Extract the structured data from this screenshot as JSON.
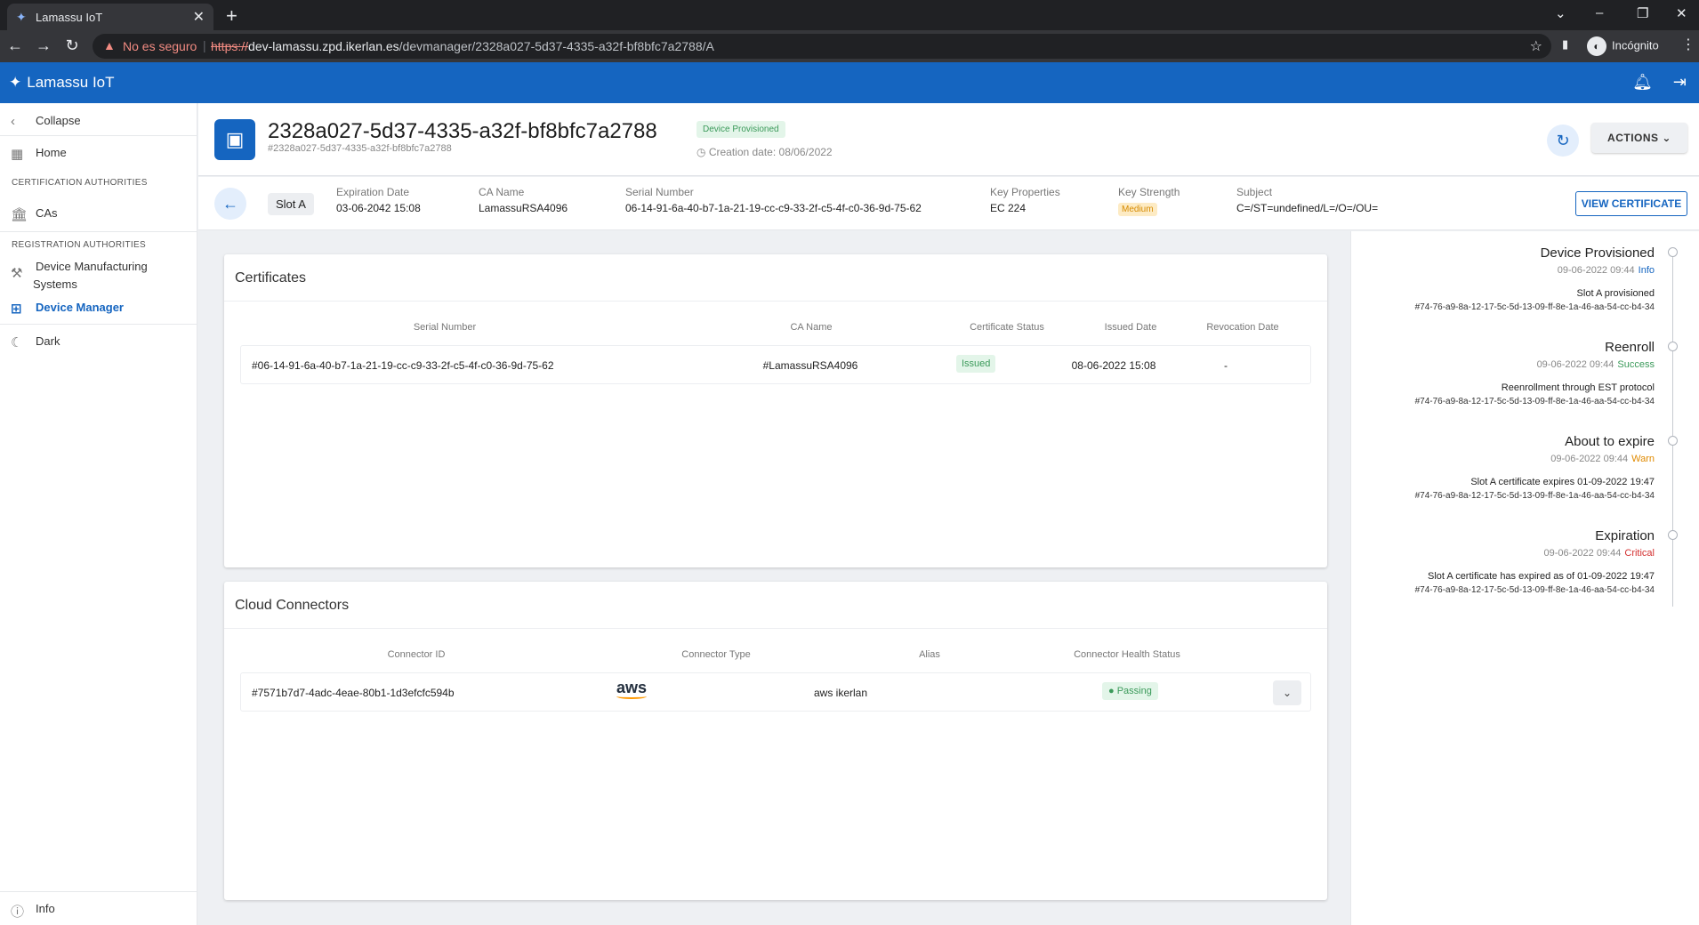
{
  "browser": {
    "tab_title": "Lamassu IoT",
    "tab_close": "✕",
    "new_tab": "+",
    "insecure_label": "No es seguro",
    "url_scheme": "https://",
    "url_host": "dev-lamassu.zpd.ikerlan.es",
    "url_path": "/devmanager/2328a027-5d37-4335-a32f-bf8bfc7a2788/A",
    "incognito_label": "Incógnito"
  },
  "app": {
    "brand": "Lamassu IoT"
  },
  "sidebar": {
    "collapse": "Collapse",
    "home": "Home",
    "section_ca": "CERTIFICATION AUTHORITIES",
    "cas": "CAs",
    "section_ra": "REGISTRATION AUTHORITIES",
    "dms_line1": "Device Manufacturing",
    "dms_line2": "Systems",
    "device_manager": "Device Manager",
    "dark": "Dark",
    "info": "Info"
  },
  "device": {
    "title": "2328a027-5d37-4335-a32f-bf8bfc7a2788",
    "subid": "#2328a027-5d37-4335-a32f-bf8bfc7a2788",
    "status_badge": "Device Provisioned",
    "creation": "Creation date: 08/06/2022",
    "actions_label": "ACTIONS"
  },
  "slot": {
    "label": "Slot A",
    "expiration_key": "Expiration Date",
    "expiration_val": "03-06-2042 15:08",
    "ca_key": "CA Name",
    "ca_val": "LamassuRSA4096",
    "serial_key": "Serial Number",
    "serial_val": "06-14-91-6a-40-b7-1a-21-19-cc-c9-33-2f-c5-4f-c0-36-9d-75-62",
    "keyprop_key": "Key Properties",
    "keyprop_val": "EC 224",
    "strength_key": "Key Strength",
    "strength_val": "Medium",
    "subject_key": "Subject",
    "subject_val": "C=/ST=undefined/L=/O=/OU=",
    "view_cert": "VIEW CERTIFICATE"
  },
  "certificates": {
    "title": "Certificates",
    "headers": [
      "Serial Number",
      "CA Name",
      "Certificate Status",
      "Issued Date",
      "Revocation Date"
    ],
    "row": {
      "serial": "#06-14-91-6a-40-b7-1a-21-19-cc-c9-33-2f-c5-4f-c0-36-9d-75-62",
      "ca": "#LamassuRSA4096",
      "status": "Issued",
      "issued": "08-06-2022 15:08",
      "revocation": "-"
    }
  },
  "connectors": {
    "title": "Cloud Connectors",
    "headers": [
      "Connector ID",
      "Connector Type",
      "Alias",
      "Connector Health Status"
    ],
    "row": {
      "id": "#7571b7d7-4adc-4eae-80b1-1d3efcfc594b",
      "type": "aws",
      "alias": "aws ikerlan",
      "health": "Passing"
    }
  },
  "timeline": [
    {
      "title": "Device Provisioned",
      "date": "09-06-2022 09:44",
      "level": "Info",
      "message": "Slot A provisioned",
      "hash": "#74-76-a9-8a-12-17-5c-5d-13-09-ff-8e-1a-46-aa-54-cc-b4-34"
    },
    {
      "title": "Reenroll",
      "date": "09-06-2022 09:44",
      "level": "Success",
      "message": "Reenrollment through EST protocol",
      "hash": "#74-76-a9-8a-12-17-5c-5d-13-09-ff-8e-1a-46-aa-54-cc-b4-34"
    },
    {
      "title": "About to expire",
      "date": "09-06-2022 09:44",
      "level": "Warn",
      "message": "Slot A certificate expires 01-09-2022 19:47",
      "hash": "#74-76-a9-8a-12-17-5c-5d-13-09-ff-8e-1a-46-aa-54-cc-b4-34"
    },
    {
      "title": "Expiration",
      "date": "09-06-2022 09:44",
      "level": "Critical",
      "message": "Slot A certificate has expired as of 01-09-2022 19:47",
      "hash": "#74-76-a9-8a-12-17-5c-5d-13-09-ff-8e-1a-46-aa-54-cc-b4-34"
    }
  ],
  "colors": {
    "primary": "#1565c0",
    "success": "#3b9a5a",
    "warn": "#e08a00",
    "critical": "#d32f2f"
  }
}
